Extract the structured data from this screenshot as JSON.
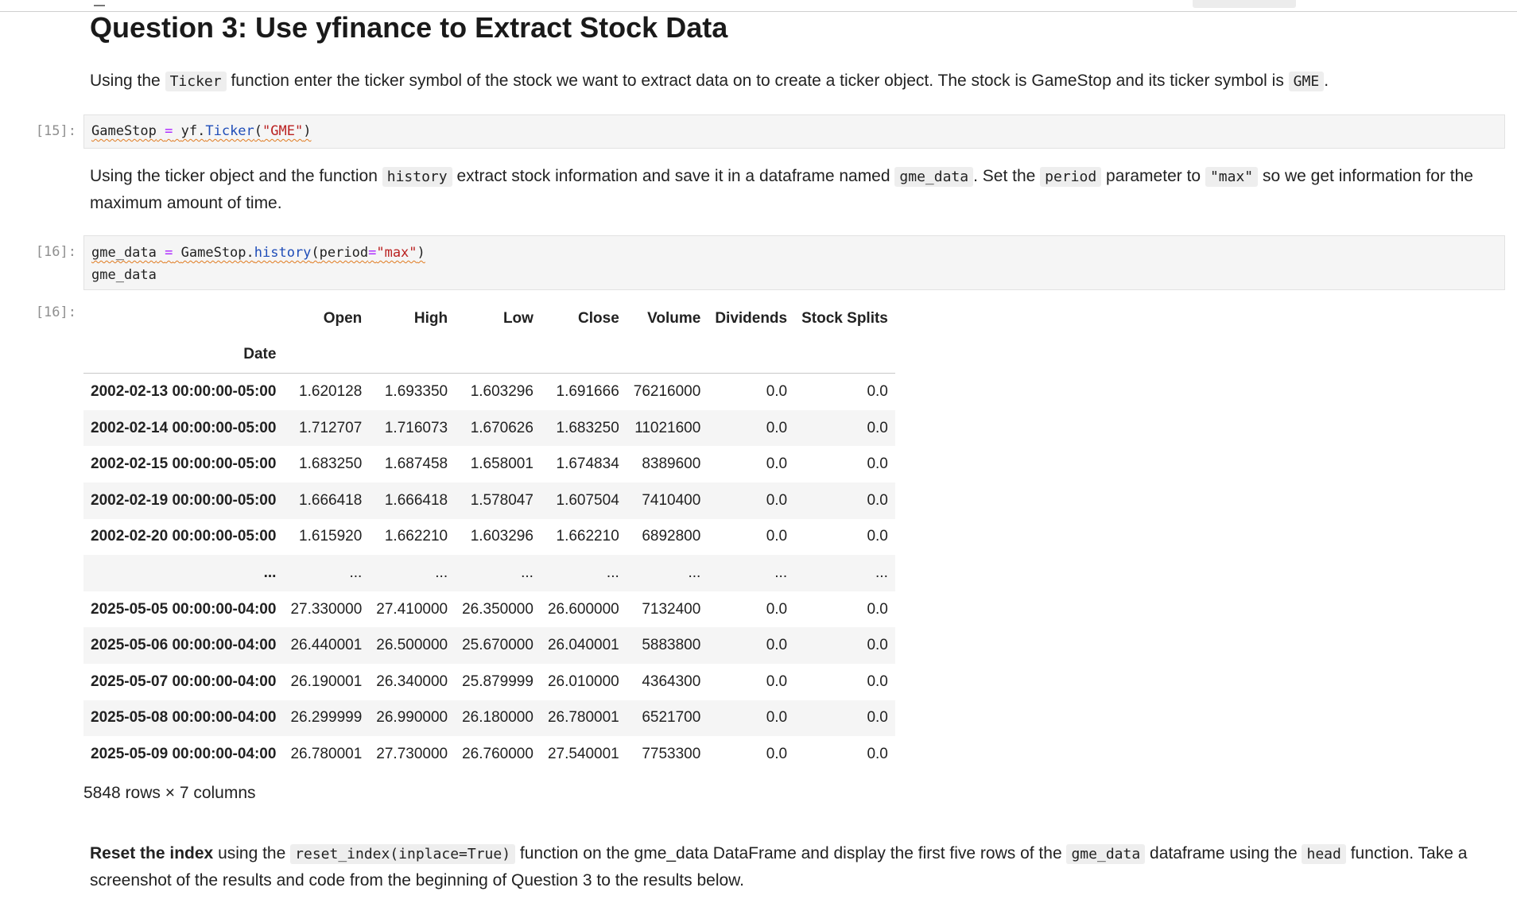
{
  "heading": "Question 3: Use yfinance to Extract Stock Data",
  "para1": {
    "t1": "Using the",
    "c1": "Ticker",
    "t2": "function enter the ticker symbol of the stock we want to extract data on to create a ticker object. The stock is GameStop and its ticker symbol is",
    "c2": "GME",
    "t3": "."
  },
  "cell15": {
    "prompt": "[15]:",
    "var": "GameStop",
    "eq": "=",
    "mod": "yf.",
    "fn": "Ticker",
    "open": "(",
    "arg": "\"GME\"",
    "close": ")"
  },
  "para2": {
    "t1": "Using the ticker object and the function",
    "c1": "history",
    "t2": "extract stock information and save it in a dataframe named",
    "c2": "gme_data",
    "t3": ". Set the",
    "c3": "period",
    "t4": "parameter to",
    "c4": "\"max\"",
    "t5": "so we get information for the maximum amount of time."
  },
  "cell16": {
    "prompt": "[16]:",
    "var": "gme_data",
    "eq": "=",
    "obj": "GameStop.",
    "fn": "history",
    "open": "(",
    "kw": "period",
    "eq2": "=",
    "arg": "\"max\"",
    "close": ")",
    "line2": "gme_data"
  },
  "out16": {
    "prompt": "[16]:",
    "index_name": "Date",
    "columns": [
      "Open",
      "High",
      "Low",
      "Close",
      "Volume",
      "Dividends",
      "Stock Splits"
    ],
    "rows": [
      {
        "index": "2002-02-13 00:00:00-05:00",
        "values": [
          "1.620128",
          "1.693350",
          "1.603296",
          "1.691666",
          "76216000",
          "0.0",
          "0.0"
        ]
      },
      {
        "index": "2002-02-14 00:00:00-05:00",
        "values": [
          "1.712707",
          "1.716073",
          "1.670626",
          "1.683250",
          "11021600",
          "0.0",
          "0.0"
        ]
      },
      {
        "index": "2002-02-15 00:00:00-05:00",
        "values": [
          "1.683250",
          "1.687458",
          "1.658001",
          "1.674834",
          "8389600",
          "0.0",
          "0.0"
        ]
      },
      {
        "index": "2002-02-19 00:00:00-05:00",
        "values": [
          "1.666418",
          "1.666418",
          "1.578047",
          "1.607504",
          "7410400",
          "0.0",
          "0.0"
        ]
      },
      {
        "index": "2002-02-20 00:00:00-05:00",
        "values": [
          "1.615920",
          "1.662210",
          "1.603296",
          "1.662210",
          "6892800",
          "0.0",
          "0.0"
        ]
      },
      {
        "index": "...",
        "values": [
          "...",
          "...",
          "...",
          "...",
          "...",
          "...",
          "..."
        ]
      },
      {
        "index": "2025-05-05 00:00:00-04:00",
        "values": [
          "27.330000",
          "27.410000",
          "26.350000",
          "26.600000",
          "7132400",
          "0.0",
          "0.0"
        ]
      },
      {
        "index": "2025-05-06 00:00:00-04:00",
        "values": [
          "26.440001",
          "26.500000",
          "25.670000",
          "26.040001",
          "5883800",
          "0.0",
          "0.0"
        ]
      },
      {
        "index": "2025-05-07 00:00:00-04:00",
        "values": [
          "26.190001",
          "26.340000",
          "25.879999",
          "26.010000",
          "4364300",
          "0.0",
          "0.0"
        ]
      },
      {
        "index": "2025-05-08 00:00:00-04:00",
        "values": [
          "26.299999",
          "26.990000",
          "26.180000",
          "26.780001",
          "6521700",
          "0.0",
          "0.0"
        ]
      },
      {
        "index": "2025-05-09 00:00:00-04:00",
        "values": [
          "26.780001",
          "27.730000",
          "26.760000",
          "27.540001",
          "7753300",
          "0.0",
          "0.0"
        ]
      }
    ],
    "shape": "5848 rows × 7 columns"
  },
  "para3": {
    "bold": "Reset the index",
    "t1": "using the",
    "c1": "reset_index(inplace=True)",
    "t2": "function on the gme_data DataFrame and display the first five rows of the",
    "c2": "gme_data",
    "t3": "dataframe using the",
    "c3": "head",
    "t4": "function. Take a screenshot of the results and code from the beginning of Question 3 to the results below."
  },
  "colors": {
    "code_bg": "#f5f5f5",
    "prompt": "#8f8f8f",
    "keyword_fn": "#1f4db8",
    "string": "#ba2121",
    "operator": "#aa22ff",
    "spell_underline": "#e07a1f"
  }
}
